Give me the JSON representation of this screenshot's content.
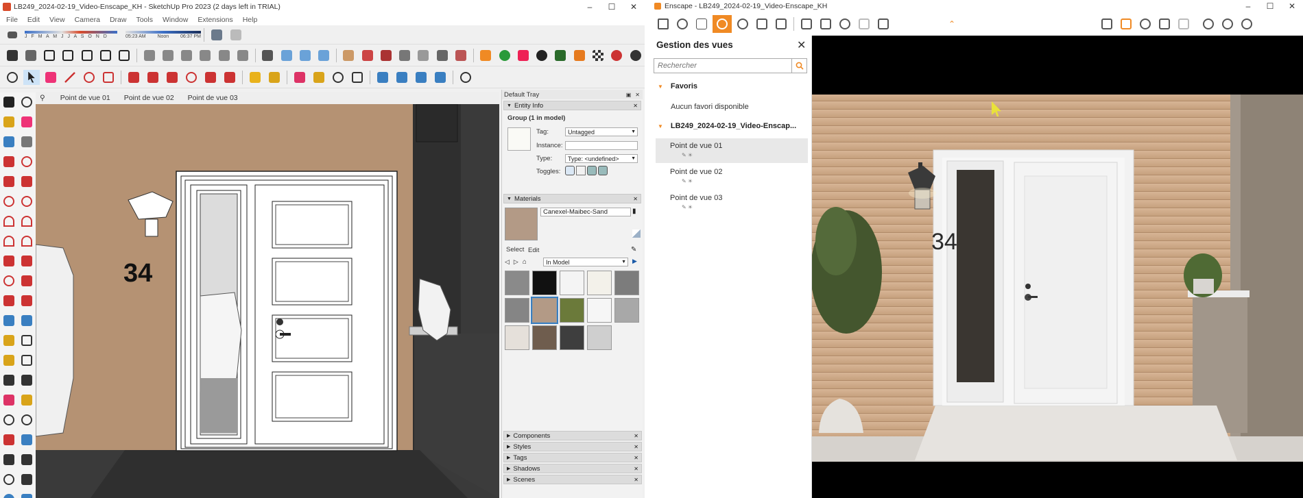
{
  "sketchup": {
    "title": "LB249_2024-02-19_Video-Enscape_KH - SketchUp Pro 2023 (2 days left in TRIAL)",
    "menu": [
      "File",
      "Edit",
      "View",
      "Camera",
      "Draw",
      "Tools",
      "Window",
      "Extensions",
      "Help"
    ],
    "shadow_months": "J F M A M J J A S O N D",
    "shadow_time_start": "05:23 AM",
    "shadow_time_noon": "Noon",
    "shadow_time_end": "06:37 PM",
    "scene_tabs": [
      "Point de vue 01",
      "Point de vue 02",
      "Point de vue 03"
    ],
    "house_number": "34",
    "tray": {
      "title": "Default Tray",
      "entity_info": {
        "header": "Entity Info",
        "selection": "Group (1 in model)",
        "tag_label": "Tag:",
        "tag_value": "Untagged",
        "instance_label": "Instance:",
        "instance_value": "",
        "type_label": "Type:",
        "type_value": "Type: <undefined>",
        "toggles_label": "Toggles:"
      },
      "materials": {
        "header": "Materials",
        "material_name": "Canexel-Maibec-Sand",
        "tab_select": "Select",
        "tab_edit": "Edit",
        "collection": "In Model",
        "swatch_colors": [
          "#8a8a8a",
          "#111111",
          "#f4f4f4",
          "#f3f1ea",
          "#7c7c7c",
          "#858585",
          "#b39a86",
          "#6b7a3a",
          "#f6f6f6",
          "#a8a8a8",
          "#e5e0da",
          "#6f5d4e",
          "#3e3e3e",
          "#cfcfcf"
        ]
      },
      "collapsed_panels": [
        "Components",
        "Styles",
        "Tags",
        "Shadows",
        "Scenes"
      ]
    }
  },
  "enscape": {
    "title": "Enscape - LB249_2024-02-19_Video-Enscape_KH",
    "accent": "#f08a24",
    "panel": {
      "title": "Gestion des vues",
      "search_placeholder": "Rechercher",
      "favorites_label": "Favoris",
      "no_favorites": "Aucun favori disponible",
      "project_label": "LB249_2024-02-19_Video-Enscap...",
      "views": [
        "Point de vue 01",
        "Point de vue 02",
        "Point de vue 03"
      ]
    },
    "house_number": "34"
  }
}
